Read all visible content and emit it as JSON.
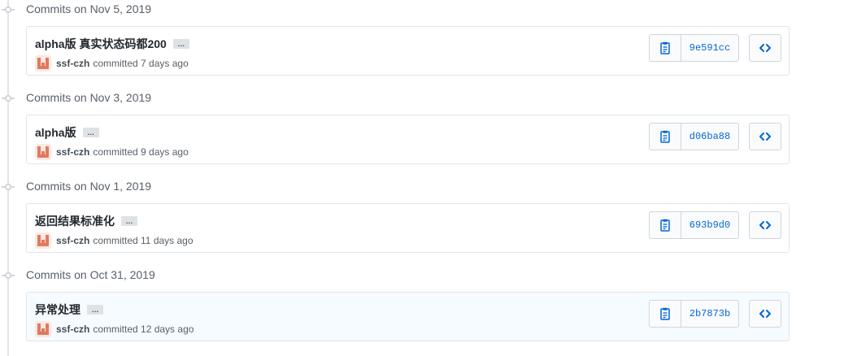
{
  "groups": [
    {
      "title": "Commits on Nov 5, 2019",
      "commit": {
        "message": "alpha版 真实状态码都200",
        "author": "ssf-czh",
        "time": "committed 7 days ago",
        "sha": "9e591cc"
      }
    },
    {
      "title": "Commits on Nov 3, 2019",
      "commit": {
        "message": "alpha版",
        "author": "ssf-czh",
        "time": "committed 9 days ago",
        "sha": "d06ba88"
      }
    },
    {
      "title": "Commits on Nov 1, 2019",
      "commit": {
        "message": "返回结果标准化",
        "author": "ssf-czh",
        "time": "committed 11 days ago",
        "sha": "693b9d0"
      }
    },
    {
      "title": "Commits on Oct 31, 2019",
      "commit": {
        "message": "异常处理",
        "author": "ssf-czh",
        "time": "committed 12 days ago",
        "sha": "2b7873b"
      }
    }
  ],
  "ellipsis_label": "…",
  "icons": {
    "timeline_dot": "commit-dot-icon",
    "copy": "clipboard-icon",
    "browse": "code-icon",
    "avatar": "identicon-avatar"
  },
  "colors": {
    "sha_link": "#0366d6",
    "avatar": "#e07a5f",
    "highlight_bg": "#f6fbff"
  }
}
